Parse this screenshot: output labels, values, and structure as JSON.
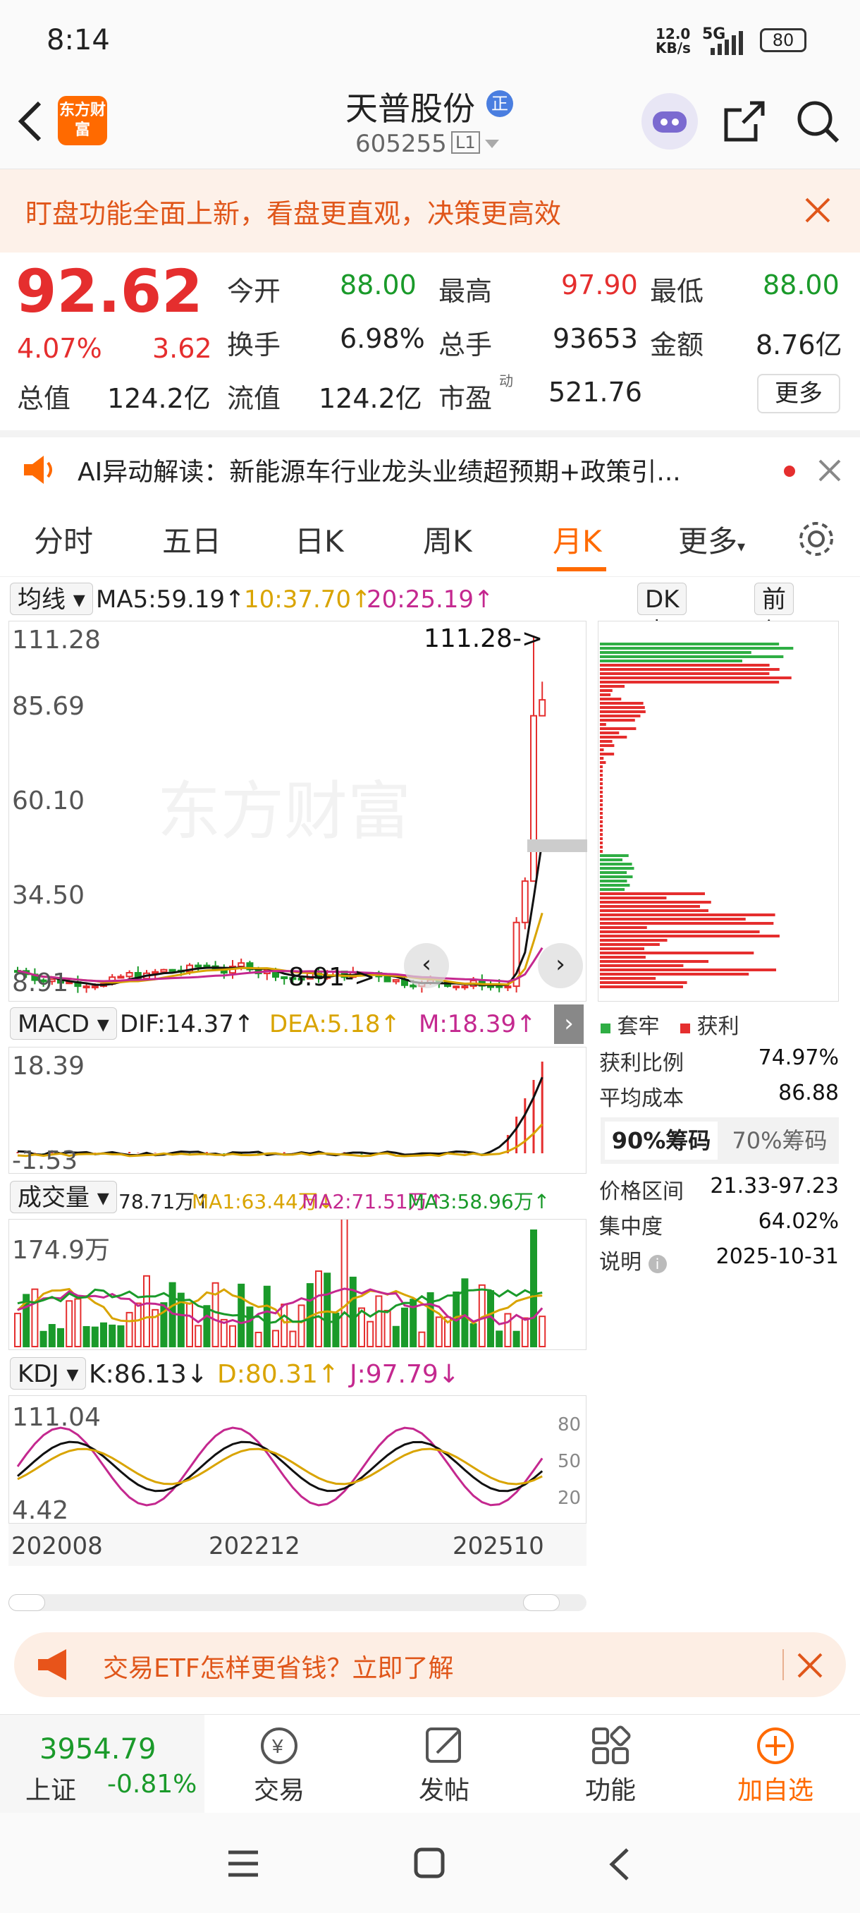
{
  "status": {
    "time": "8:14",
    "net_speed": "12.0\nKB/s",
    "net_speed_top": "12.0",
    "net_speed_bottom": "KB/s",
    "network": "5G",
    "battery": "80"
  },
  "header": {
    "logo_text": "东方财富",
    "stock_name": "天普股份",
    "badge": "正",
    "stock_code": "605255",
    "level": "L1"
  },
  "banner": {
    "text": "盯盘功能全面上新，看盘更直观，决策更高效"
  },
  "quote": {
    "price": "92.62",
    "change_pct": "4.07%",
    "change": "3.62",
    "open_label": "今开",
    "open": "88.00",
    "high_label": "最高",
    "high": "97.90",
    "low_label": "最低",
    "low": "88.00",
    "turnover_label": "换手",
    "turnover": "6.98%",
    "volume_label": "总手",
    "volume": "93653",
    "amount_label": "金额",
    "amount": "8.76亿",
    "total_mv_label": "总值",
    "total_mv": "124.2亿",
    "float_mv_label": "流值",
    "float_mv": "124.2亿",
    "pe_label": "市盈",
    "pe_sup": "动",
    "pe": "521.76",
    "more_label": "更多"
  },
  "ai": {
    "text": "AI异动解读：新能源车行业龙头业绩超预期+政策引..."
  },
  "tabs": [
    "分时",
    "五日",
    "日K",
    "周K",
    "月K",
    "更多"
  ],
  "active_tab": 4,
  "kchart": {
    "ma_selector": "均线",
    "ma5": "MA5:59.19↑",
    "ma10": "10:37.70↑",
    "ma20": "20:25.19↑",
    "dk_label": "DK点",
    "adj_label": "前复权",
    "y_labels": [
      "111.28",
      "85.69",
      "60.10",
      "34.50",
      "8.91"
    ],
    "max_annot": "111.28->",
    "min_annot": "8.91->",
    "watermark": "东方财富"
  },
  "macd": {
    "selector": "MACD",
    "dif": "DIF:14.37↑",
    "dea": "DEA:5.18↑",
    "m": "M:18.39↑",
    "y_top": "18.39",
    "y_bottom": "-1.53"
  },
  "vol": {
    "selector": "成交量",
    "v": "78.71万↑",
    "ma1": "MA1:63.44万↓",
    "ma2": "MA2:71.51万↑",
    "ma3": "MA3:58.96万↑",
    "y_top": "174.9万"
  },
  "kdj": {
    "selector": "KDJ",
    "k": "K:86.13↓",
    "d": "D:80.31↑",
    "j": "J:97.79↓",
    "y_top": "111.04",
    "y_bottom": "4.42",
    "levels": [
      "80",
      "50",
      "20"
    ]
  },
  "dates": [
    "202008",
    "202212",
    "202510"
  ],
  "chips": {
    "legend_trap": "套牢",
    "legend_profit": "获利",
    "profit_ratio_label": "获利比例",
    "profit_ratio": "74.97%",
    "avg_cost_label": "平均成本",
    "avg_cost": "86.88",
    "tab90": "90%筹码",
    "tab70": "70%筹码",
    "range_label": "价格区间",
    "range": "21.33-97.23",
    "conc_label": "集中度",
    "conc": "64.02%",
    "note_label": "说明",
    "note_date": "2025-10-31"
  },
  "etf_banner": {
    "text": "交易ETF怎样更省钱？立即了解"
  },
  "bottom": {
    "index_value": "3954.79",
    "index_name": "上证",
    "index_change": "-0.81%",
    "trade": "交易",
    "post": "发帖",
    "func": "功能",
    "add": "加自选"
  },
  "colors": {
    "up": "#e52e2e",
    "down": "#1a9a2a",
    "accent": "#ff6a00",
    "ma10": "#d9a400",
    "ma20": "#c4288f"
  },
  "chart_data": {
    "type": "candlestick",
    "title": "",
    "series_volume_peak": "174.9万",
    "price_max": 111.28,
    "price_min": 8.91,
    "last_close": 92.62
  }
}
